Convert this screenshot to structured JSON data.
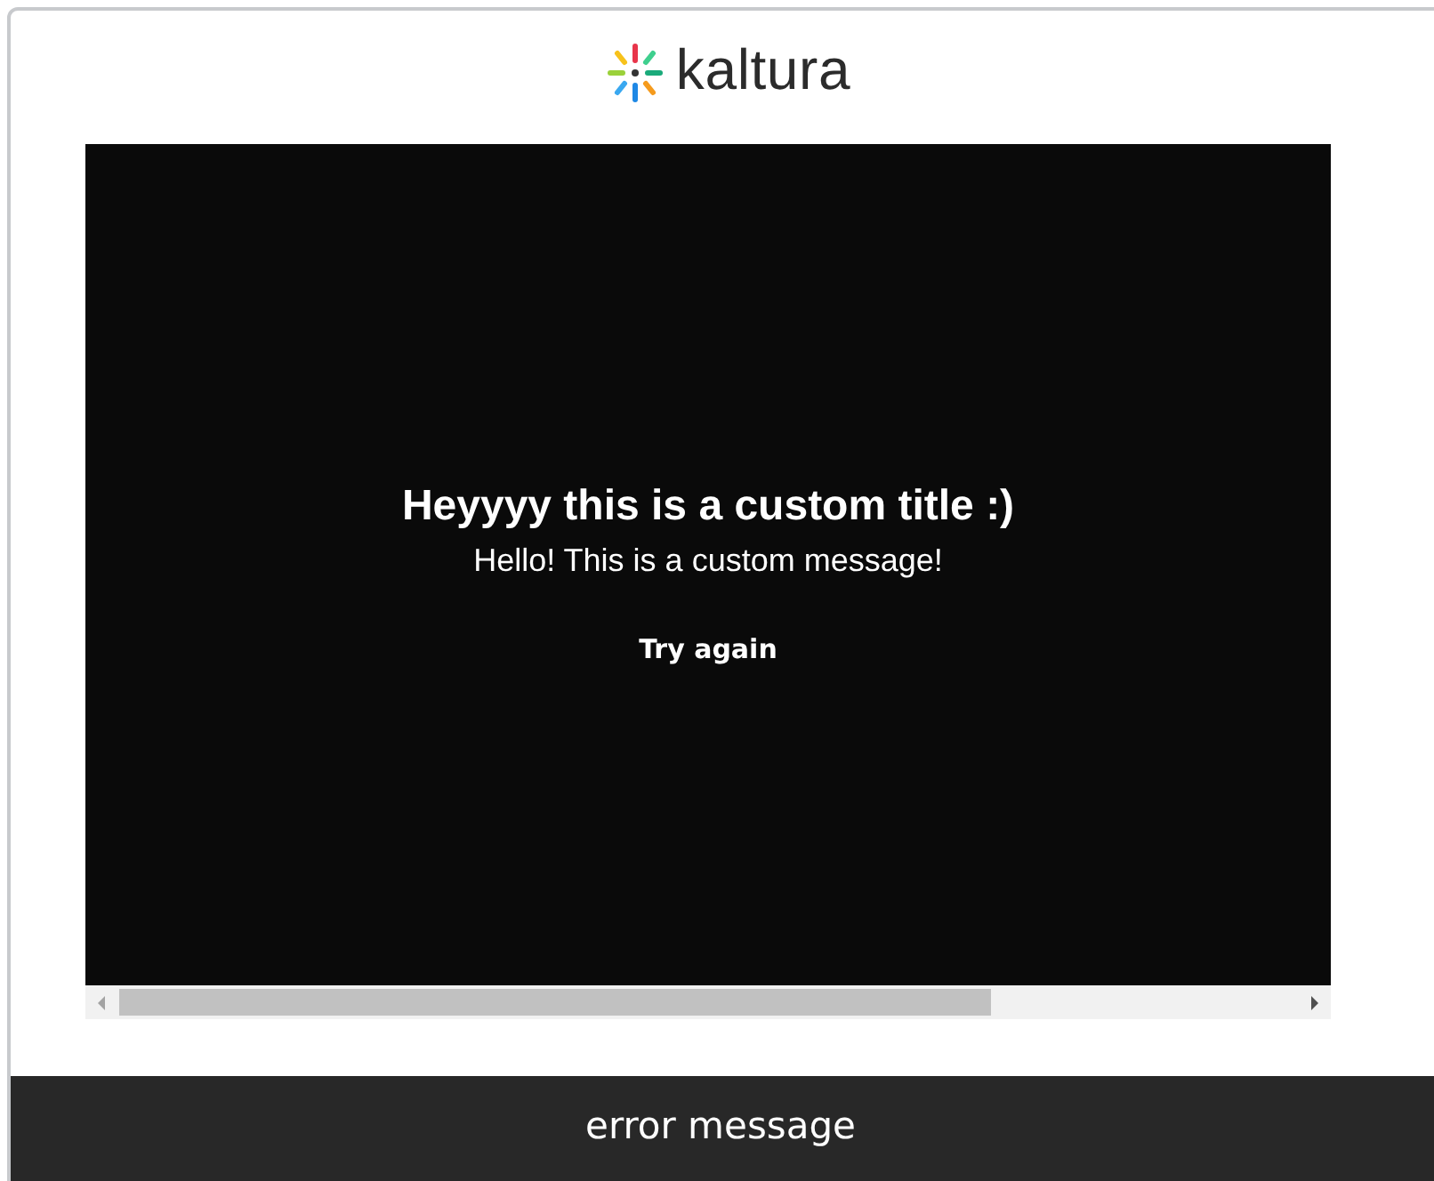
{
  "logo": {
    "text": "kaltura"
  },
  "player": {
    "error_title": "Heyyyy this is a custom title :)",
    "error_message": "Hello! This is a custom message!",
    "retry_button": "Try again"
  },
  "caption": "error message"
}
